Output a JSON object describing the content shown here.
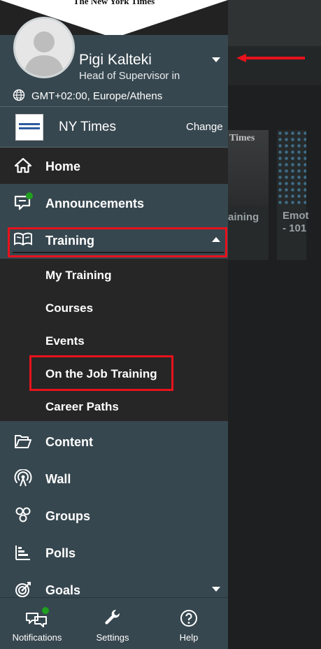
{
  "background": {
    "card1_caption": "aining",
    "card1_logo": "Times",
    "card2_caption_line1": "Emot",
    "card2_caption_line2": "- 101"
  },
  "drawer": {
    "banner_logo": "The New York Times",
    "user": {
      "name": "Pigi Kalteki",
      "role": "Head of Supervisor in"
    },
    "timezone": "GMT+02:00, Europe/Athens",
    "organization": {
      "name": "NY Times",
      "change_label": "Change"
    },
    "nav": {
      "home": "Home",
      "announcements": "Announcements",
      "training": "Training",
      "training_sub": [
        "My Training",
        "Courses",
        "Events",
        "On the Job Training",
        "Career Paths"
      ],
      "content": "Content",
      "wall": "Wall",
      "groups": "Groups",
      "polls": "Polls",
      "goals": "Goals"
    },
    "bottom": {
      "notifications": "Notifications",
      "settings": "Settings",
      "help": "Help"
    }
  },
  "colors": {
    "drawer_bg": "#37474f",
    "selected_bg": "#262626",
    "highlight_red": "#e8121c",
    "notification_green": "#1fa01f"
  }
}
